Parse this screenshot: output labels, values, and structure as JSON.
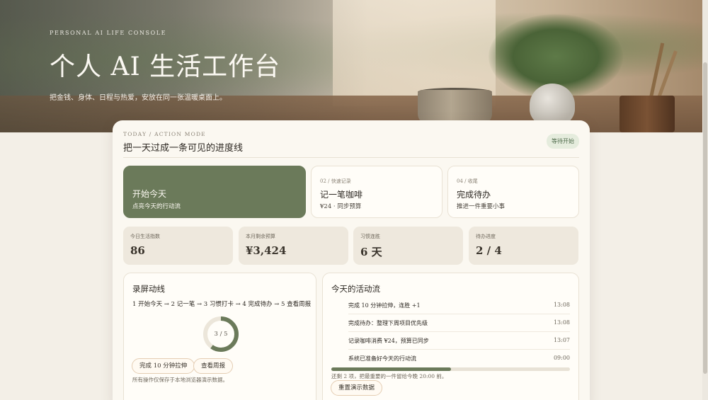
{
  "hero": {
    "kicker": "PERSONAL AI LIFE CONSOLE",
    "title": "个人 AI 生活工作台",
    "subtitle": "把金钱、身体、日程与热爱，安放在同一张温暖桌面上。"
  },
  "panel": {
    "kicker": "TODAY / ACTION MODE",
    "title": "把一天过成一条可见的进度线",
    "status": "等待开始"
  },
  "actions": [
    {
      "kicker": "",
      "title": "开始今天",
      "subtitle": "点亮今天的行动流"
    },
    {
      "kicker": "02 / 快速记录",
      "title": "记一笔咖啡",
      "subtitle": "¥24 · 同步预算"
    },
    {
      "kicker": "04 / 收尾",
      "title": "完成待办",
      "subtitle": "推进一件重要小事"
    }
  ],
  "stats": [
    {
      "label": "今日生活指数",
      "value": "86"
    },
    {
      "label": "本月剩余预算",
      "value": "¥3,424"
    },
    {
      "label": "习惯连胜",
      "value": "6 天"
    },
    {
      "label": "待办进度",
      "value": "2 / 4"
    }
  ],
  "flow": {
    "title": "录屏动线",
    "steps_text": "1 开始今天 → 2 记一笔 → 3 习惯打卡 → 4 完成待办 → 5 查看周报",
    "ring_label": "3 / 5",
    "ring_progress": 0.6,
    "button_stretch": "完成 10 分钟拉伸",
    "button_weekly": "查看周报",
    "note": "所有操作仅保存于本地浏览器演示数据。"
  },
  "activity": {
    "title": "今天的活动流",
    "items": [
      {
        "text": "完成 10 分钟拉伸，连胜 +1",
        "time": "13:08"
      },
      {
        "text": "完成待办：整理下周项目优先级",
        "time": "13:08"
      },
      {
        "text": "记录咖啡消费 ¥24，预算已同步",
        "time": "13:07"
      },
      {
        "text": "系统已准备好今天的行动流",
        "time": "09:00"
      }
    ],
    "progress": 0.5,
    "note": "还剩 2 项，把最重要的一件留给今晚 20:00 前。",
    "reset_label": "重置演示数据"
  },
  "colors": {
    "accent": "#6b7a5a",
    "panel_bg": "#fbf8f1",
    "page_bg": "#f3efe7"
  }
}
